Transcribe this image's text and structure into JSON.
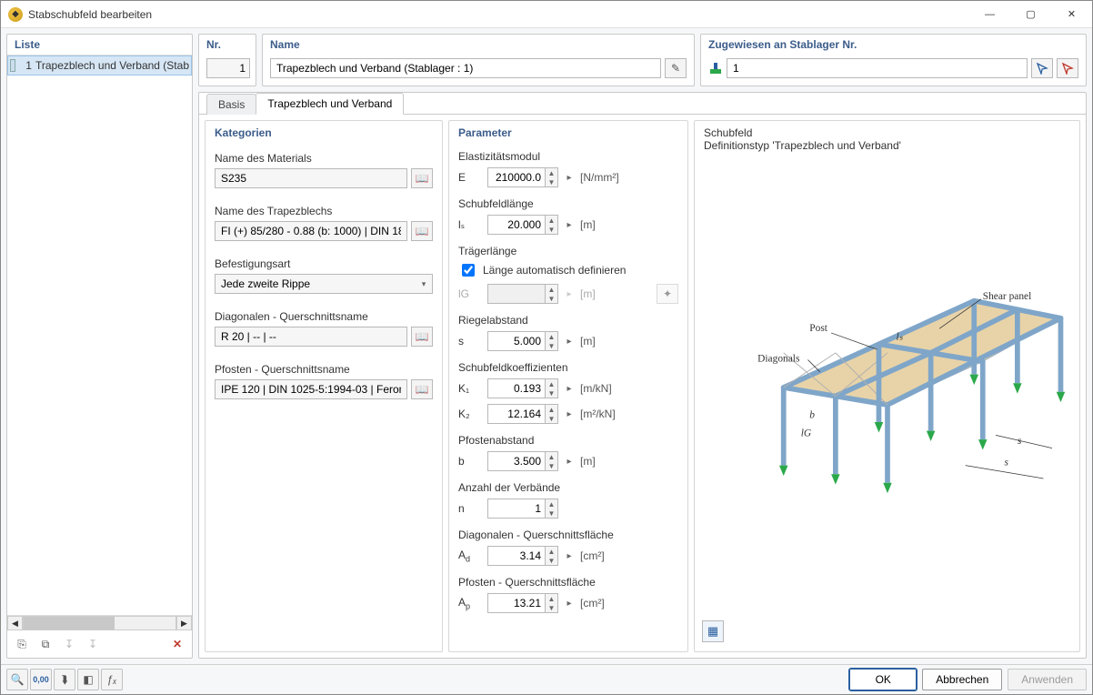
{
  "window": {
    "title": "Stabschubfeld bearbeiten"
  },
  "win_controls": {
    "min": "—",
    "max": "▢",
    "close": "✕"
  },
  "liste": {
    "header": "Liste",
    "items": [
      {
        "num": "1",
        "label": "Trapezblech und Verband (Stab"
      }
    ]
  },
  "left_toolbar": {
    "new": "⎘",
    "copy": "⧉",
    "sort_num": "↧",
    "sort_alpha": "↧",
    "delete": "✕"
  },
  "nr": {
    "header": "Nr.",
    "value": "1"
  },
  "name": {
    "header": "Name",
    "value": "Trapezblech und Verband (Stablager : 1)"
  },
  "zugewiesen": {
    "header": "Zugewiesen an Stablager Nr.",
    "value": "1"
  },
  "tabs": {
    "basis": "Basis",
    "trap": "Trapezblech und Verband"
  },
  "kategorien": {
    "header": "Kategorien",
    "material_label": "Name des Materials",
    "material_value": "S235",
    "trapez_label": "Name des Trapezblechs",
    "trapez_value": "FI (+) 85/280 - 0.88 (b: 1000) | DIN 18",
    "befest_label": "Befestigungsart",
    "befest_value": "Jede zweite Rippe",
    "diag_label": "Diagonalen - Querschnittsname",
    "diag_value": "R 20 | -- | --",
    "pfosten_label": "Pfosten - Querschnittsname",
    "pfosten_value": "IPE 120 | DIN 1025-5:1994-03 | Feron"
  },
  "parameter": {
    "header": "Parameter",
    "e_label": "Elastizitätsmodul",
    "e_sym": "E",
    "e_val": "210000.0",
    "e_unit": "[N/mm²]",
    "ls_label": "Schubfeldlänge",
    "ls_sym": "lₛ",
    "ls_val": "20.000",
    "ls_unit": "[m]",
    "lg_label": "Trägerlänge",
    "lg_auto": "Länge automatisch definieren",
    "lg_sym": "lG",
    "lg_val": "",
    "lg_unit": "[m]",
    "s_label": "Riegelabstand",
    "s_sym": "s",
    "s_val": "5.000",
    "s_unit": "[m]",
    "k_label": "Schubfeldkoeffizienten",
    "k1_sym": "K₁",
    "k1_val": "0.193",
    "k1_unit": "[m/kN]",
    "k2_sym": "K₂",
    "k2_val": "12.164",
    "k2_unit": "[m²/kN]",
    "b_label": "Pfostenabstand",
    "b_sym": "b",
    "b_val": "3.500",
    "b_unit": "[m]",
    "n_label": "Anzahl der Verbände",
    "n_sym": "n",
    "n_val": "1",
    "ad_label": "Diagonalen - Querschnittsfläche",
    "ad_sym": "Ad",
    "ad_val": "3.14",
    "ad_unit": "[cm²]",
    "ap_label": "Pfosten - Querschnittsfläche",
    "ap_sym": "Ap",
    "ap_val": "13.21",
    "ap_unit": "[cm²]"
  },
  "schubfeld": {
    "header": "Schubfeld",
    "subheader": "Definitionstyp 'Trapezblech und Verband'",
    "labels": {
      "post": "Post",
      "diagonals": "Diagonals",
      "shear": "Shear panel",
      "ls": "lₛ",
      "b": "b",
      "lg": "lG",
      "s": "s"
    }
  },
  "bottom_tools": {
    "help": "?",
    "units": "0,00",
    "pick": "⇲",
    "mode1": "◧",
    "fx": "ƒₓ"
  },
  "buttons": {
    "ok": "OK",
    "cancel": "Abbrechen",
    "apply": "Anwenden"
  }
}
